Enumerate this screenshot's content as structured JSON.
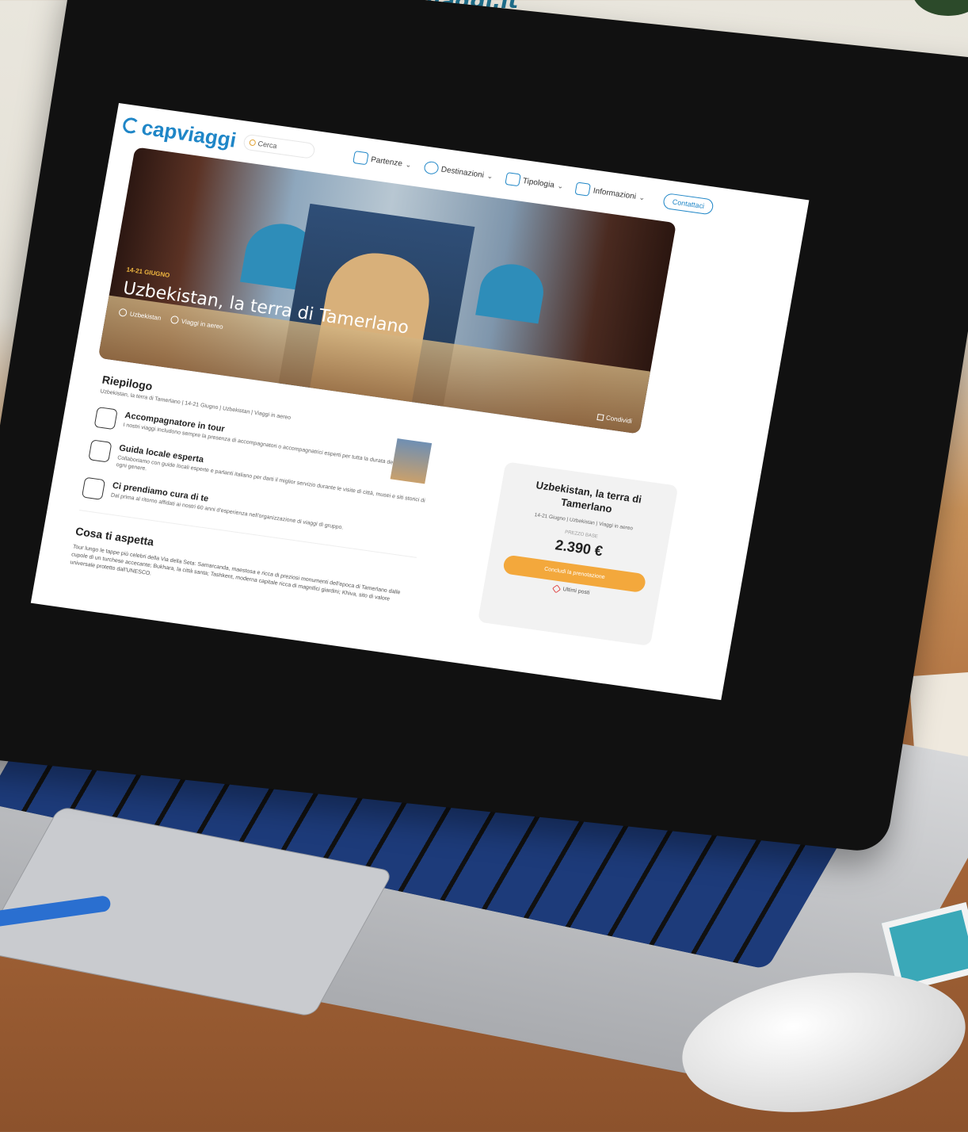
{
  "scene": {
    "url": "www.capviaggi.it"
  },
  "header": {
    "logo": "capviaggi",
    "search_label": "Cerca",
    "nav": [
      {
        "label": "Partenze"
      },
      {
        "label": "Destinazioni"
      },
      {
        "label": "Tipologia"
      },
      {
        "label": "Informazioni"
      }
    ],
    "contact": "Contattaci"
  },
  "hero": {
    "date": "14-21 GIUGNO",
    "title": "Uzbekistan, la terra di Tamerlano",
    "tags": [
      "Uzbekistan",
      "Viaggi in aereo"
    ],
    "share": "Condividi"
  },
  "summary": {
    "heading": "Riepilogo",
    "subtitle": "Uzbekistan, la terra di Tamerlano | 14-21 Giugno | Uzbekistan | Viaggi in aereo",
    "features": [
      {
        "title": "Accompagnatore in tour",
        "desc": "I nostri viaggi includono sempre la presenza di accompagnatori o accompagnatrici esperti per tutta la durata del viaggio."
      },
      {
        "title": "Guida locale esperta",
        "desc": "Collaboriamo con guide locali esperte e parlanti italiano per darti il miglior servizio durante le visite di città, musei e siti storici di ogni genere."
      },
      {
        "title": "Ci prendiamo cura di te",
        "desc": "Dal prima al ritorno affidati ai nostri 60 anni d'esperienza nell'organizzazione di viaggi di gruppo."
      }
    ]
  },
  "about": {
    "heading": "Cosa ti aspetta",
    "text": "Tour lungo le tappe più celebri della Via della Seta: Samarcanda, maestosa e ricca di preziosi monumenti dell'epoca di Tamerlano dalle cupole di un turchese accecante; Bukhara, la città santa; Tashkent, moderna capitale ricca di magnifici giardini; Khiva, sito di valore universale protetto dall'UNESCO."
  },
  "booking_card": {
    "title": "Uzbekistan, la terra di Tamerlano",
    "sub": "14-21 Giugno | Uzbekistan | Viaggi in aereo",
    "price_label": "PREZZO BASE",
    "price": "2.390 €",
    "cta": "Concludi la prenotazione",
    "urgency": "Ultimi posti",
    "cta_color": "#f3a83c"
  }
}
